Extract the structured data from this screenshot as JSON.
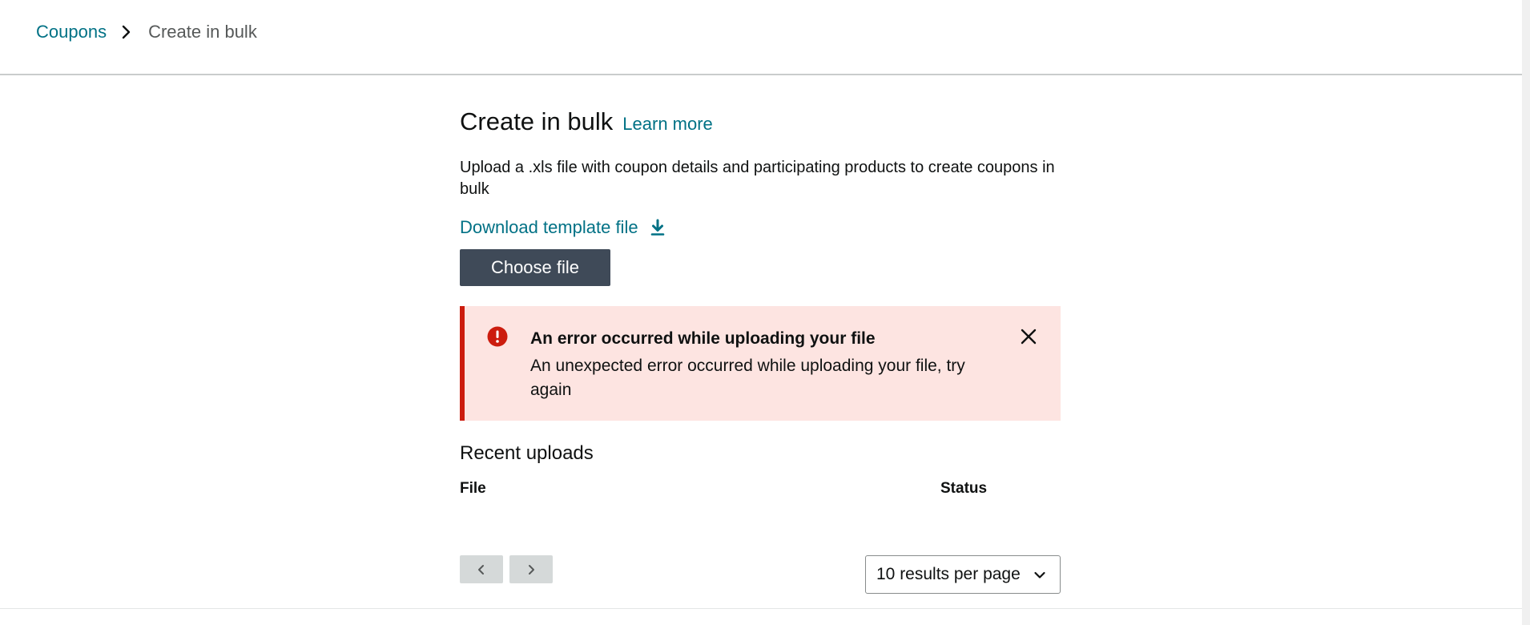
{
  "breadcrumb": {
    "parent": "Coupons",
    "current": "Create in bulk"
  },
  "header": {
    "title": "Create in bulk",
    "learn_more": "Learn more"
  },
  "description": "Upload a .xls file with coupon details and participating products to create coupons in bulk",
  "download": {
    "label": "Download template file",
    "icon": "download-icon"
  },
  "upload": {
    "choose_label": "Choose file"
  },
  "alert": {
    "title": "An error occurred while uploading your file",
    "body": "An unexpected error occurred while uploading your file, try again",
    "icon": "error-icon",
    "color": "#cc1c0e"
  },
  "recent_uploads": {
    "title": "Recent uploads",
    "columns": [
      "File",
      "Status"
    ],
    "rows": []
  },
  "pagination": {
    "per_page_label": "10 results per page",
    "prev_icon": "chevron-left-icon",
    "next_icon": "chevron-right-icon"
  },
  "colors": {
    "link": "#007185",
    "button": "#3f4a58",
    "alert_bg": "#fde4e1"
  }
}
